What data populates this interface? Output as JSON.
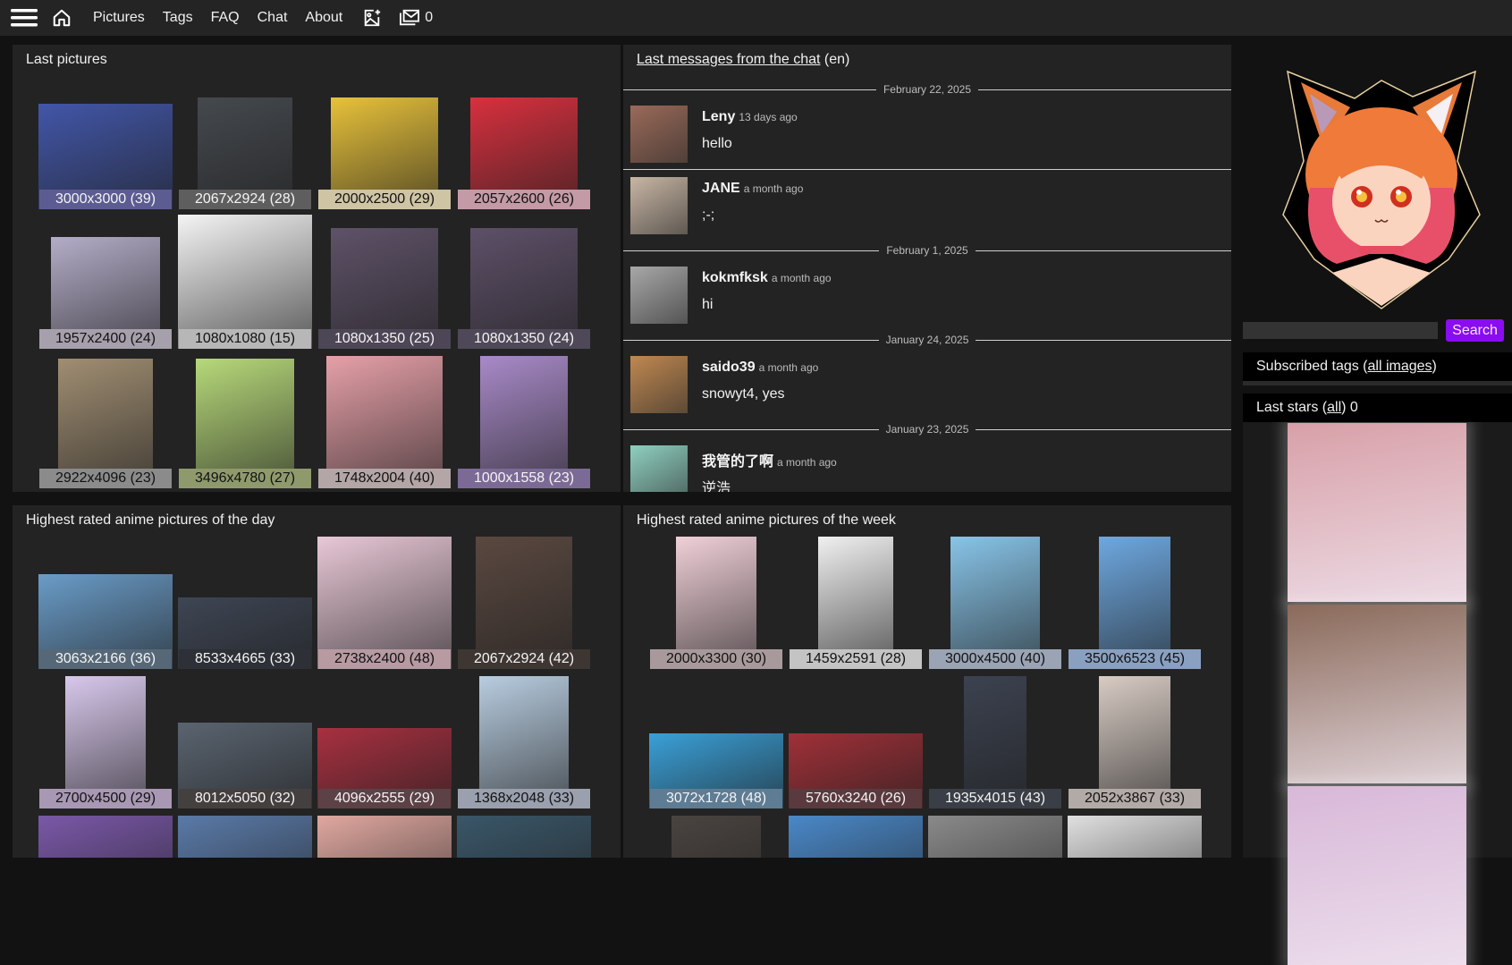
{
  "nav": {
    "menu_icon": "hamburger-menu-icon",
    "home_icon": "home-icon",
    "links": [
      "Pictures",
      "Tags",
      "FAQ",
      "Chat",
      "About"
    ],
    "upload_icon": "add-image-icon",
    "messages_icon": "mail-inbox-icon",
    "messages_count": "0"
  },
  "last_pictures": {
    "title": "Last pictures",
    "items": [
      {
        "caption": "3000x3000 (39)",
        "bar": "#5c5c92",
        "dark": true,
        "thumb": "#4256a8"
      },
      {
        "caption": "2067x2924 (28)",
        "bar": "#5e5e5e",
        "dark": true,
        "thumb": "#45494e"
      },
      {
        "caption": "2000x2500 (29)",
        "bar": "#cfc4a4",
        "dark": false,
        "thumb": "#e8c23a"
      },
      {
        "caption": "2057x2600 (26)",
        "bar": "#c49aa6",
        "dark": false,
        "thumb": "#d8303e"
      },
      {
        "caption": "1957x2400 (24)",
        "bar": "#a6a0ad",
        "dark": false,
        "thumb": "#b4adc8"
      },
      {
        "caption": "1080x1080 (15)",
        "bar": "#b7b7b7",
        "dark": false,
        "thumb": "#f4f4f4"
      },
      {
        "caption": "1080x1350 (25)",
        "bar": "#4d4656",
        "dark": true,
        "thumb": "#5e5268"
      },
      {
        "caption": "1080x1350 (24)",
        "bar": "#4f4858",
        "dark": true,
        "thumb": "#5d5068"
      },
      {
        "caption": "2922x4096 (23)",
        "bar": "#8b8b8b",
        "dark": false,
        "thumb": "#a08e72"
      },
      {
        "caption": "3496x4780 (27)",
        "bar": "#8f9a6c",
        "dark": false,
        "thumb": "#b7d97a"
      },
      {
        "caption": "1748x2004 (40)",
        "bar": "#b4a6a6",
        "dark": false,
        "thumb": "#e6a0a8"
      },
      {
        "caption": "1000x1558 (23)",
        "bar": "#7c6a96",
        "dark": true,
        "thumb": "#a88ac8"
      }
    ]
  },
  "chat": {
    "title_link": "Last messages from the chat",
    "title_suffix": " (en)",
    "entries": [
      {
        "type": "date",
        "text": "February 22, 2025"
      },
      {
        "type": "msg",
        "user": "Leny",
        "ago": "13 days ago",
        "text": "hello",
        "avatar": "#9a6a58"
      },
      {
        "type": "msg",
        "user": "JANE",
        "ago": "a month ago",
        "text": ";-;",
        "avatar": "#c8b6a4"
      },
      {
        "type": "date",
        "text": "February 1, 2025"
      },
      {
        "type": "msg",
        "user": "kokmfksk",
        "ago": "a month ago",
        "text": "hi",
        "avatar": "#a8a8a8"
      },
      {
        "type": "date",
        "text": "January 24, 2025"
      },
      {
        "type": "msg",
        "user": "saido39",
        "ago": "a month ago",
        "text": "snowyt4, yes",
        "avatar": "#c08850"
      },
      {
        "type": "date",
        "text": "January 23, 2025"
      },
      {
        "type": "msg",
        "user": "我管的了啊",
        "ago": "a month ago",
        "text": "逆浩",
        "avatar": "#8fd0c0"
      }
    ]
  },
  "day_top": {
    "title": "Highest rated anime pictures of the day",
    "items": [
      {
        "caption": "3063x2166 (36)",
        "bar": "#566878",
        "dark": true,
        "thumb": "#6a9cc8"
      },
      {
        "caption": "8533x4665 (33)",
        "bar": "#2d3036",
        "dark": true,
        "thumb": "#3e4654"
      },
      {
        "caption": "2738x2400 (48)",
        "bar": "#b79aa2",
        "dark": false,
        "thumb": "#e8c8d6"
      },
      {
        "caption": "2067x2924 (42)",
        "bar": "#3e3632",
        "dark": true,
        "thumb": "#5a4840"
      },
      {
        "caption": "2700x4500 (29)",
        "bar": "#a898b4",
        "dark": false,
        "thumb": "#d8c8ec"
      },
      {
        "caption": "8012x5050 (32)",
        "bar": "#454040",
        "dark": true,
        "thumb": "#5a6470"
      },
      {
        "caption": "4096x2555 (29)",
        "bar": "#5c4146",
        "dark": true,
        "thumb": "#a83040"
      },
      {
        "caption": "1368x2048 (33)",
        "bar": "#9aa0ae",
        "dark": false,
        "thumb": "#b8cde0"
      },
      {
        "caption": "",
        "bar": "",
        "dark": false,
        "thumb": "#7a58a8"
      },
      {
        "caption": "",
        "bar": "",
        "dark": false,
        "thumb": "#5a7aa8"
      },
      {
        "caption": "",
        "bar": "",
        "dark": false,
        "thumb": "#e0a8a0"
      },
      {
        "caption": "",
        "bar": "",
        "dark": false,
        "thumb": "#3a5668"
      }
    ]
  },
  "week_top": {
    "title": "Highest rated anime pictures of the week",
    "items": [
      {
        "caption": "2000x3300 (30)",
        "bar": "#a89a9c",
        "dark": false,
        "thumb": "#f0d0d8"
      },
      {
        "caption": "1459x2591 (28)",
        "bar": "#c4c4c4",
        "dark": false,
        "thumb": "#f0f0f0"
      },
      {
        "caption": "3000x4500 (40)",
        "bar": "#9aa4b4",
        "dark": false,
        "thumb": "#88c4e8"
      },
      {
        "caption": "3500x6523 (45)",
        "bar": "#8aa0c0",
        "dark": false,
        "thumb": "#6ea8e0"
      },
      {
        "caption": "3072x1728 (48)",
        "bar": "#5e7c94",
        "dark": true,
        "thumb": "#3aa0d8"
      },
      {
        "caption": "5760x3240 (26)",
        "bar": "#5a3a3e",
        "dark": true,
        "thumb": "#a03038"
      },
      {
        "caption": "1935x4015 (43)",
        "bar": "#3a3e46",
        "dark": true,
        "thumb": "#3c4250"
      },
      {
        "caption": "2052x3867 (33)",
        "bar": "#b2aaa6",
        "dark": false,
        "thumb": "#d8ccc4"
      },
      {
        "caption": "",
        "bar": "",
        "dark": false,
        "thumb": "#4a4440"
      },
      {
        "caption": "",
        "bar": "",
        "dark": false,
        "thumb": "#4a88c8"
      },
      {
        "caption": "",
        "bar": "",
        "dark": false,
        "thumb": "#8a8a8a"
      },
      {
        "caption": "",
        "bar": "",
        "dark": false,
        "thumb": "#e0e0e0"
      }
    ]
  },
  "sidebar": {
    "mascot_alt": "Fox-eared anime girl mascot",
    "search_placeholder": "",
    "search_button": "Search",
    "subscribed_prefix": "Subscribed tags (",
    "subscribed_link": "all images",
    "subscribed_suffix": ")",
    "stars_prefix": "Last stars (",
    "stars_link": "all",
    "stars_suffix": ") 0",
    "star_images": [
      "#d8a0a8",
      "#8a6a5a",
      "#d8b8d8"
    ]
  }
}
